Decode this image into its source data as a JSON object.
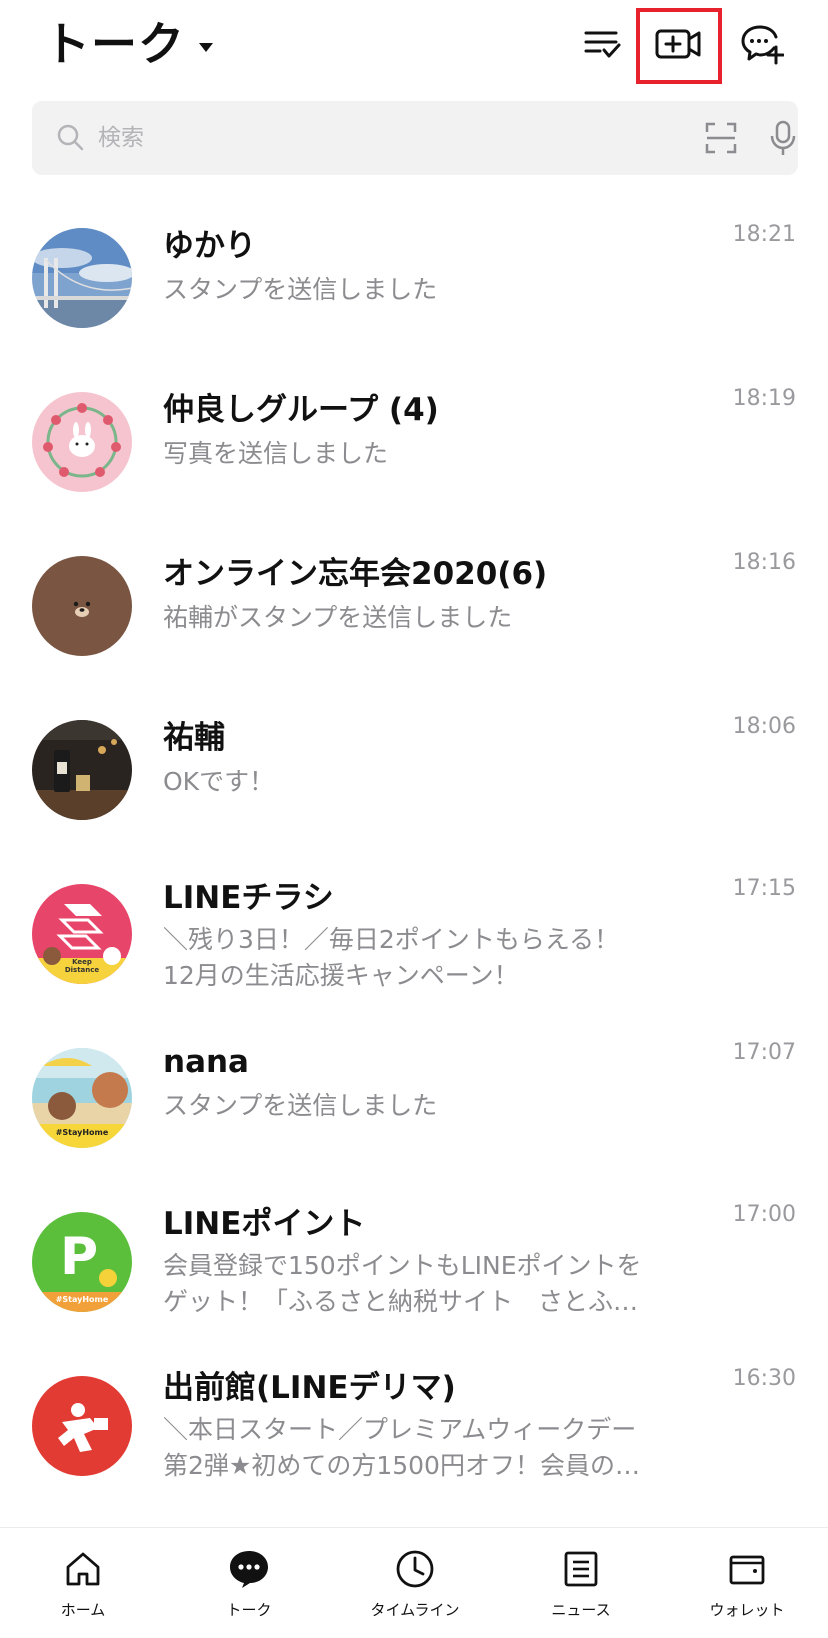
{
  "header": {
    "title": "トーク"
  },
  "search": {
    "placeholder": "検索"
  },
  "chats": [
    {
      "name": "ゆかり",
      "time": "18:21",
      "message": "スタンプを送信しました",
      "message2": ""
    },
    {
      "name": "仲良しグループ (4)",
      "time": "18:19",
      "message": "写真を送信しました",
      "message2": ""
    },
    {
      "name": "オンライン忘年会2020(6)",
      "time": "18:16",
      "message": "祐輔がスタンプを送信しました",
      "message2": ""
    },
    {
      "name": "祐輔",
      "time": "18:06",
      "message": "OKです！",
      "message2": ""
    },
    {
      "name": "LINEチラシ",
      "time": "17:15",
      "message": "＼残り3日！／毎日2ポイントもらえる！",
      "message2": "12月の生活応援キャンペーン！"
    },
    {
      "name": "nana",
      "time": "17:07",
      "message": "スタンプを送信しました",
      "message2": ""
    },
    {
      "name": "LINEポイント",
      "time": "17:00",
      "message": "会員登録で150ポイントもLINEポイントを",
      "message2": "ゲット！「ふるさと納税サイト　さとふ…"
    },
    {
      "name": "出前館(LINEデリマ)",
      "time": "16:30",
      "message": "＼本日スタート／プレミアムウィークデー",
      "message2": "第2弾★初めての方1500円オフ！会員の…"
    }
  ],
  "avatar_text": {
    "keep_distance": "Keep Distance",
    "stayhome_nana": "#StayHome",
    "stayhome_point": "#StayHome",
    "point_letter": "P"
  },
  "tabs": [
    {
      "label": "ホーム",
      "icon": "home-icon"
    },
    {
      "label": "トーク",
      "icon": "chat-bubble-icon"
    },
    {
      "label": "タイムライン",
      "icon": "clock-icon"
    },
    {
      "label": "ニュース",
      "icon": "news-icon"
    },
    {
      "label": "ウォレット",
      "icon": "wallet-icon"
    }
  ],
  "colors": {
    "highlight": "#e8222d",
    "text_primary": "#111111",
    "text_secondary": "#8c8c90",
    "search_bg": "#f2f2f3"
  }
}
